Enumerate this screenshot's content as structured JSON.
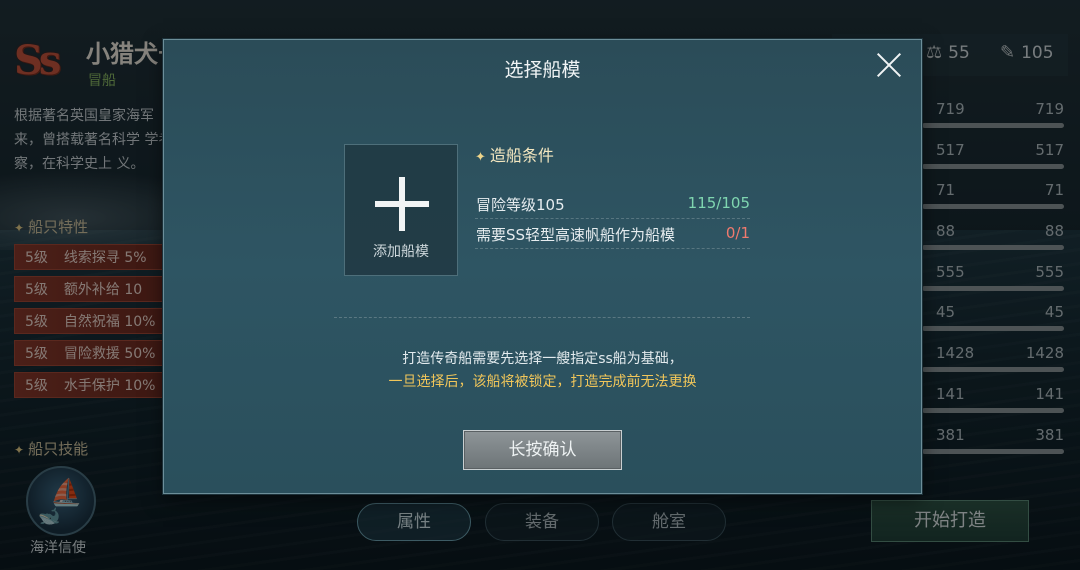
{
  "ship": {
    "grade": "Ss",
    "name": "小猎犬号",
    "type": "冒船",
    "description": "根据著名英国皇家海军 来，曾搭载著名科学 学考察，在科学史上 义。"
  },
  "sections": {
    "traits_title": "船只特性",
    "skills_title": "船只技能"
  },
  "traits": [
    {
      "level": "5级",
      "name": "线索探寻 5%"
    },
    {
      "level": "5级",
      "name": "额外补给 10"
    },
    {
      "level": "5级",
      "name": "自然祝福 10%"
    },
    {
      "level": "5级",
      "name": "冒险救援 50%"
    },
    {
      "level": "5级",
      "name": "水手保护 10%"
    }
  ],
  "skill": {
    "name": "海洋信使",
    "icon": "ship-whale-icon"
  },
  "resources": {
    "scale": "55",
    "feather": "105"
  },
  "stats": [
    {
      "left": "719",
      "right": "719"
    },
    {
      "left": "517",
      "right": "517"
    },
    {
      "left": "71",
      "right": "71"
    },
    {
      "left": "88",
      "right": "88"
    },
    {
      "left": "555",
      "right": "555"
    },
    {
      "left": "45",
      "right": "45"
    },
    {
      "left": "1428",
      "right": "1428"
    },
    {
      "left": "141",
      "right": "141"
    },
    {
      "left": "381",
      "right": "381"
    }
  ],
  "tabs": [
    "属性",
    "装备",
    "舱室"
  ],
  "start_button": "开始打造",
  "modal": {
    "title": "选择船模",
    "add_slot_label": "添加船模",
    "conditions_title": "造船条件",
    "conditions": [
      {
        "label": "冒险等级105",
        "value": "115/105",
        "color": "#7fd6b0"
      },
      {
        "label": "需要SS轻型高速帆船作为船模",
        "value": "0/1",
        "color": "#f07a6e"
      }
    ],
    "note_line1": "打造传奇船需要先选择一艘指定ss船为基础，",
    "note_line2": "一旦选择后，该船将被锁定，打造完成前无法更换",
    "confirm_button": "长按确认"
  }
}
